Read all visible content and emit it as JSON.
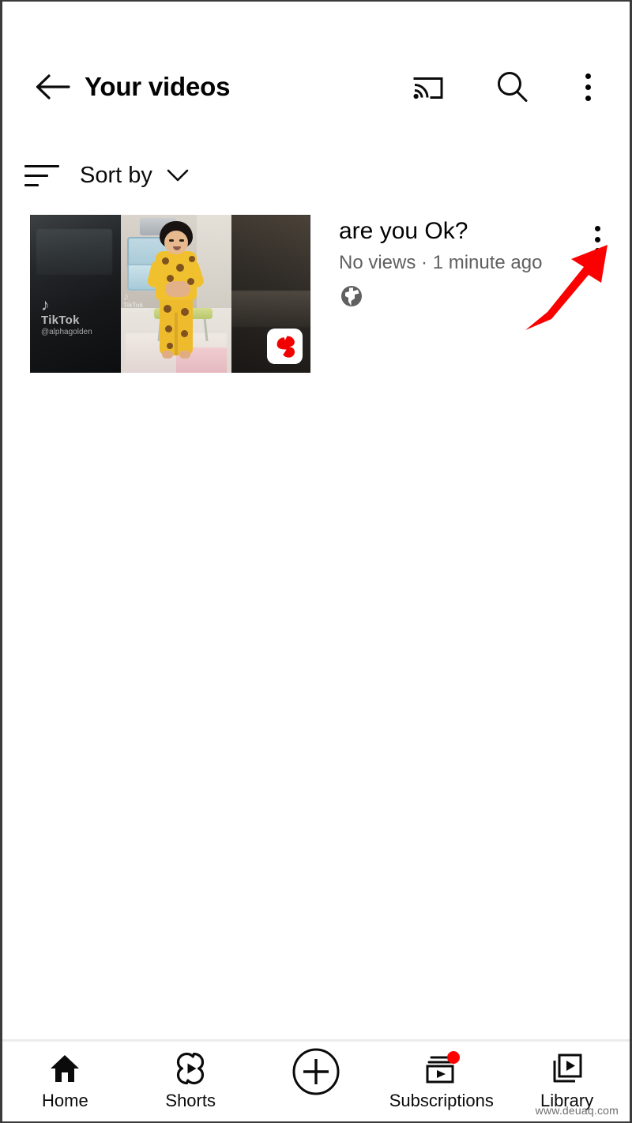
{
  "header": {
    "title": "Your videos",
    "back_icon": "arrow-left-icon",
    "cast_icon": "cast-icon",
    "search_icon": "search-icon",
    "more_icon": "more-vertical-icon"
  },
  "sort": {
    "label": "Sort by",
    "icon": "sort-lines-icon",
    "caret": "chevron-down-icon"
  },
  "videos": [
    {
      "title": "are you Ok?",
      "meta": "No views · 1 minute ago",
      "visibility_icon": "globe-public-icon",
      "badge": "shorts-badge-icon",
      "menu_icon": "more-vertical-icon",
      "thumbnail_watermark": {
        "brand": "TikTok",
        "username": "@alphagolden"
      }
    }
  ],
  "annotation": {
    "type": "red-arrow",
    "color": "#FB0000",
    "points_to": "video-row-overflow-menu"
  },
  "bottom_nav": {
    "items": [
      {
        "label": "Home",
        "icon": "home-icon",
        "active": true,
        "badge": false
      },
      {
        "label": "Shorts",
        "icon": "shorts-icon",
        "active": false,
        "badge": false
      },
      {
        "label": "",
        "icon": "plus-circle-icon",
        "active": false,
        "badge": false
      },
      {
        "label": "Subscriptions",
        "icon": "subscriptions-icon",
        "active": false,
        "badge": true
      },
      {
        "label": "Library",
        "icon": "library-icon",
        "active": false,
        "badge": false
      }
    ],
    "badge_color": "#FF0000"
  },
  "watermark": "www.deuaq.com",
  "colors": {
    "background": "#FFFFFF",
    "text_primary": "#030303",
    "text_secondary": "#606060",
    "accent_red": "#FF0000",
    "divider": "#ECECEC"
  }
}
